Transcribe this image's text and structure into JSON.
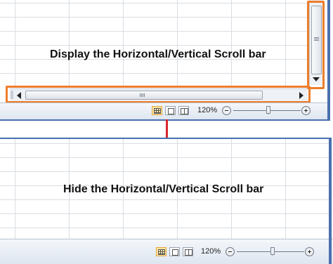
{
  "top_panel": {
    "caption": "Display the Horizontal/Vertical Scroll bar",
    "status_bar": {
      "zoom_label": "120%"
    }
  },
  "bottom_panel": {
    "caption": "Hide the Horizontal/Vertical Scroll bar",
    "status_bar": {
      "zoom_label": "120%"
    }
  },
  "colors": {
    "highlight": "#ee7d2b",
    "arrow": "#d8262b",
    "window_edge": "#4a6fae"
  },
  "zoom_level": 1.2
}
